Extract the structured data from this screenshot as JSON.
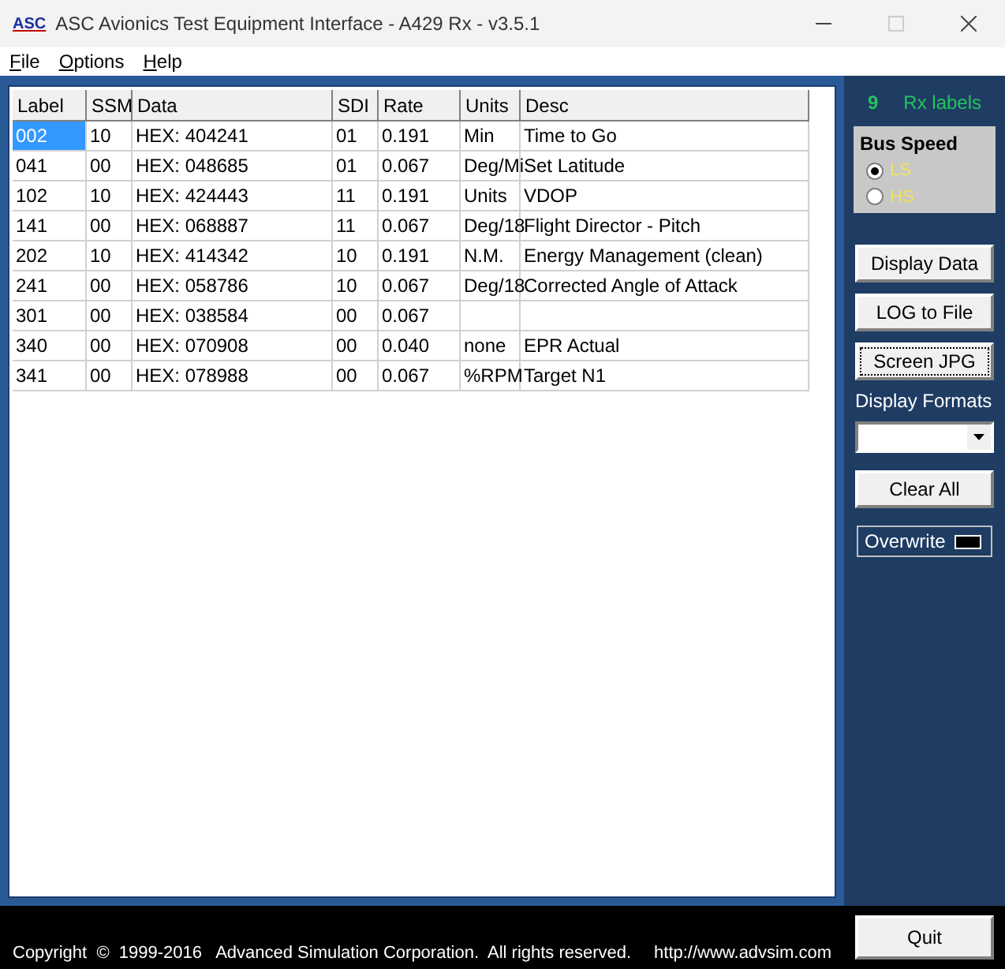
{
  "window": {
    "title": "ASC Avionics Test Equipment Interface - A429 Rx  -  v3.5.1",
    "logo": "ASC"
  },
  "menu": [
    {
      "label": "File"
    },
    {
      "label": "Options"
    },
    {
      "label": "Help"
    }
  ],
  "table": {
    "columns": [
      "Label",
      "SSM",
      "Data",
      "SDI",
      "Rate",
      "Units",
      "Desc"
    ],
    "rows": [
      {
        "selected": true,
        "cells": [
          "002",
          "10",
          "HEX: 404241",
          "01",
          "0.191",
          "Min",
          "Time to Go"
        ]
      },
      {
        "selected": false,
        "cells": [
          "041",
          "00",
          "HEX: 048685",
          "01",
          "0.067",
          "Deg/Mi",
          "Set Latitude"
        ]
      },
      {
        "selected": false,
        "cells": [
          "102",
          "10",
          "HEX: 424443",
          "11",
          "0.191",
          "Units",
          "VDOP"
        ]
      },
      {
        "selected": false,
        "cells": [
          "141",
          "00",
          "HEX: 068887",
          "11",
          "0.067",
          "Deg/18",
          "Flight Director - Pitch"
        ]
      },
      {
        "selected": false,
        "cells": [
          "202",
          "10",
          "HEX: 414342",
          "10",
          "0.191",
          "N.M.",
          "Energy Management (clean)"
        ]
      },
      {
        "selected": false,
        "cells": [
          "241",
          "00",
          "HEX: 058786",
          "10",
          "0.067",
          "Deg/18",
          "Corrected Angle of Attack"
        ]
      },
      {
        "selected": false,
        "cells": [
          "301",
          "00",
          "HEX: 038584",
          "00",
          "0.067",
          "",
          ""
        ]
      },
      {
        "selected": false,
        "cells": [
          "340",
          "00",
          "HEX: 070908",
          "00",
          "0.040",
          "none",
          "EPR Actual"
        ]
      },
      {
        "selected": false,
        "cells": [
          "341",
          "00",
          "HEX: 078988",
          "00",
          "0.067",
          "%RPM",
          "Target N1"
        ]
      }
    ]
  },
  "side": {
    "count": "9",
    "count_label": "Rx labels",
    "bus_speed": {
      "title": "Bus Speed",
      "options": [
        {
          "label": "LS",
          "selected": true
        },
        {
          "label": "HS",
          "selected": false
        }
      ]
    },
    "buttons": [
      "Display Data",
      "LOG to File",
      "Screen JPG"
    ],
    "formats_label": "Display Formats",
    "clear": "Clear All",
    "overwrite": "Overwrite",
    "quit": "Quit"
  },
  "status_bar": {
    "copyright": "Copyright  ©  1999-2016   Advanced Simulation Corporation.  All rights reserved.",
    "url": "http://www.advsim.com"
  }
}
